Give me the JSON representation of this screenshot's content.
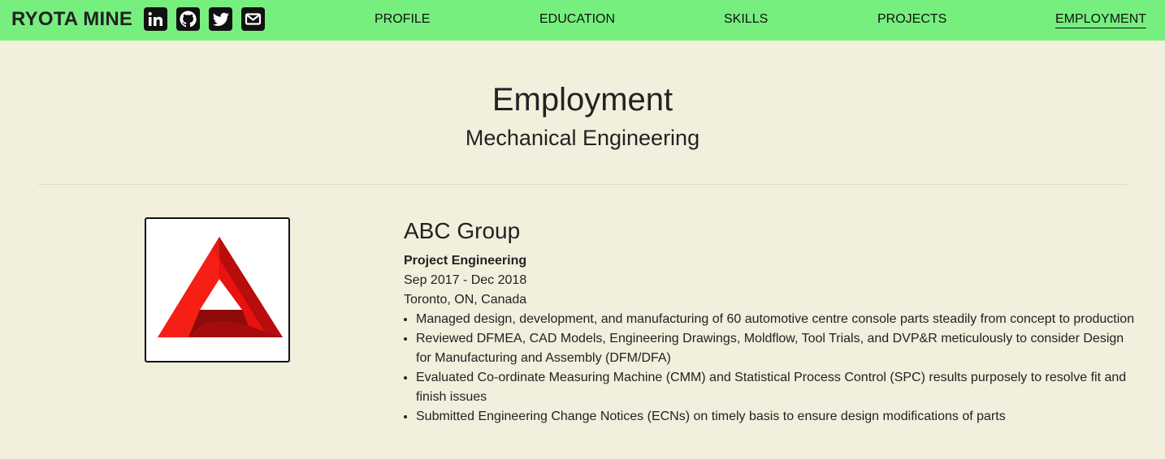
{
  "brand": "RYOTA MINE",
  "social": [
    {
      "name": "linkedin-icon",
      "glyph": "in"
    },
    {
      "name": "github-icon"
    },
    {
      "name": "twitter-icon"
    },
    {
      "name": "email-icon"
    }
  ],
  "nav": {
    "profile": "PROFILE",
    "education": "EDUCATION",
    "skills": "SKILLS",
    "projects": "PROJECTS",
    "employment": "EMPLOYMENT"
  },
  "section": {
    "title": "Employment",
    "subtitle": "Mechanical Engineering"
  },
  "job": {
    "company": "ABC Group",
    "role": "Project Engineering",
    "dates": "Sep 2017 - Dec 2018",
    "location": "Toronto, ON, Canada",
    "duties": [
      "Managed design, development, and manufacturing of 60 automotive centre console parts steadily from concept to production",
      "Reviewed DFMEA, CAD Models, Engineering Drawings, Moldflow, Tool Trials, and DVP&R meticulously to consider Design for Manufacturing and Assembly (DFM/DFA)",
      "Evaluated Co-ordinate Measuring Machine (CMM) and Statistical Process Control (SPC) results purposely to resolve fit and finish issues",
      "Submitted Engineering Change Notices (ECNs) on timely basis to ensure design modifications of parts"
    ]
  },
  "colors": {
    "navbar": "#76ef7f",
    "background": "#f2efdd",
    "logo_red": "#e8120e",
    "logo_dark_red": "#8f0a0a"
  }
}
